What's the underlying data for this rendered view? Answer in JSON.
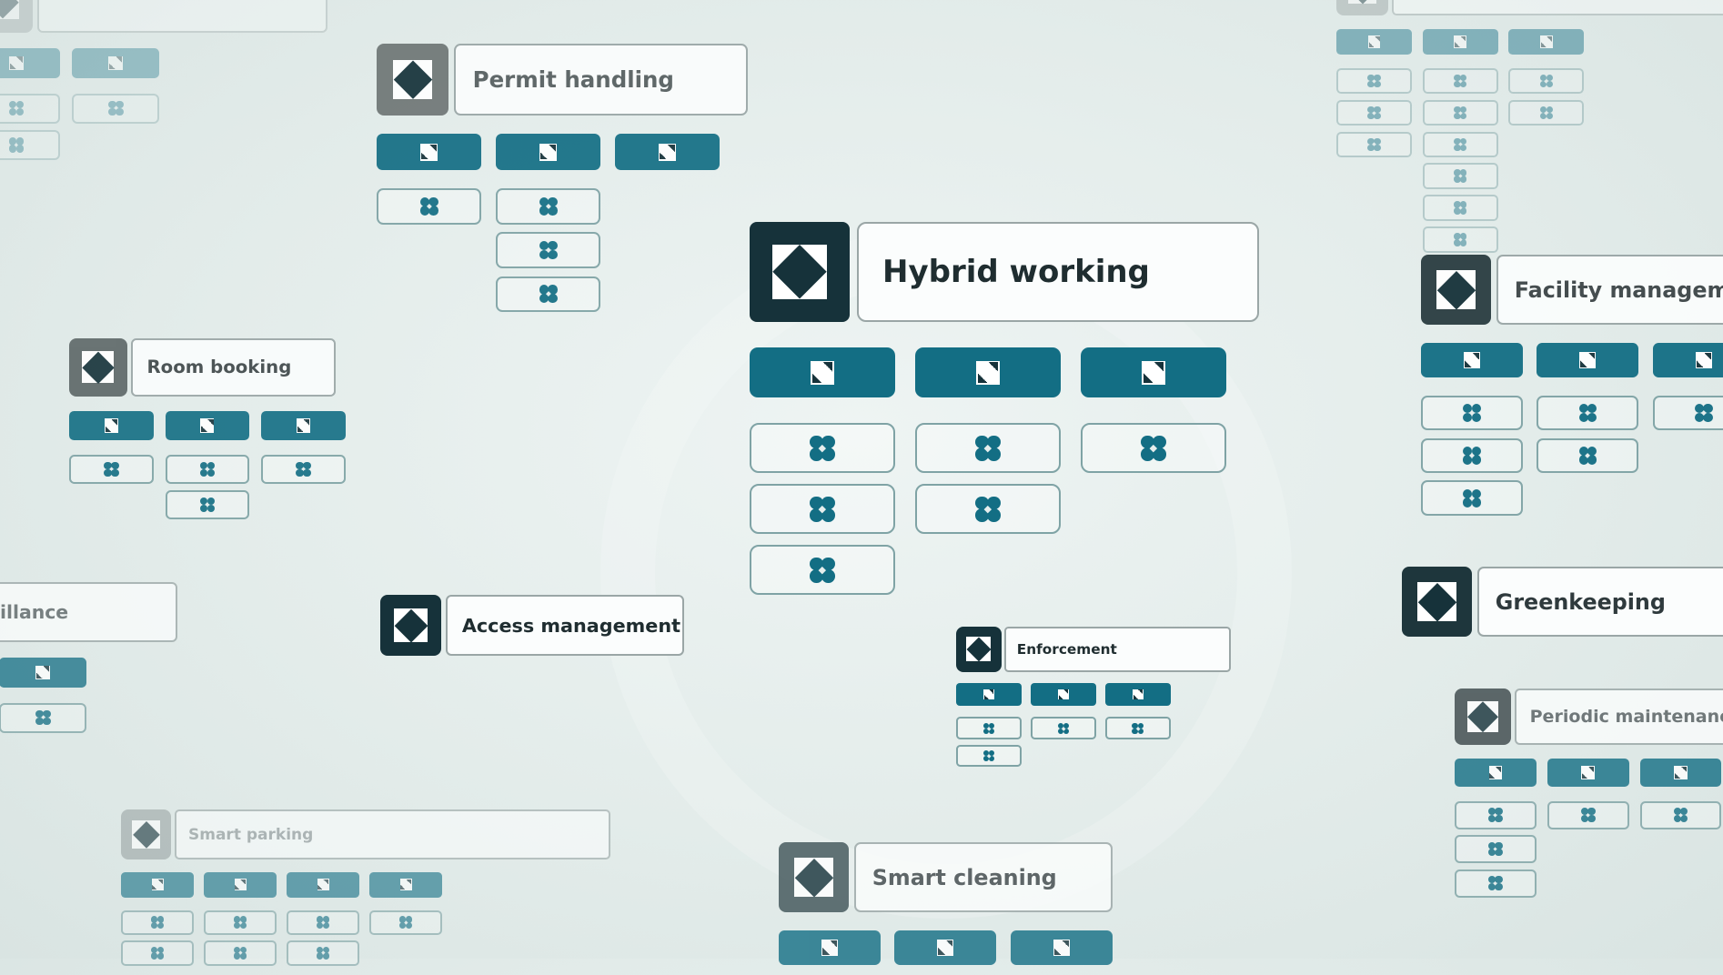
{
  "scene": {
    "description": "Modular smart-building services overview",
    "colors": {
      "accent_teal": "#136e84",
      "icon_dark": "#16323a",
      "tile_border": "#7fa3a5",
      "background": "#e3ecea",
      "title_text": "#1f2d30"
    }
  },
  "modules": [
    {
      "id": "hybrid-working",
      "title": "Hybrid working",
      "emphasis": "primary",
      "icon": "diamond-icon",
      "columns": [
        3,
        2,
        1
      ]
    },
    {
      "id": "permit-handling",
      "title": "Permit handling",
      "emphasis": "secondary",
      "icon": "diamond-icon",
      "columns": [
        1,
        3,
        0
      ]
    },
    {
      "id": "room-booking",
      "title": "Room booking",
      "emphasis": "secondary",
      "icon": "diamond-icon",
      "columns": [
        1,
        2,
        1
      ]
    },
    {
      "id": "surveillance",
      "title": "Surveillance",
      "visible_title": "rveillance",
      "emphasis": "faded",
      "icon": "diamond-icon",
      "columns": [
        2,
        1
      ]
    },
    {
      "id": "access-management",
      "title": "Access management",
      "emphasis": "secondary",
      "icon": "diamond-icon",
      "columns": []
    },
    {
      "id": "enforcement",
      "title": "Enforcement",
      "emphasis": "secondary",
      "icon": "diamond-icon",
      "columns": [
        2,
        1,
        1
      ]
    },
    {
      "id": "facility-management",
      "title": "Facility management",
      "visible_title": "Facility managemer",
      "emphasis": "secondary",
      "icon": "diamond-icon",
      "columns": [
        3,
        2,
        1
      ]
    },
    {
      "id": "greenkeeping",
      "title": "Greenkeeping",
      "emphasis": "secondary",
      "icon": "diamond-icon",
      "columns": []
    },
    {
      "id": "periodic-maintenance",
      "title": "Periodic maintenance",
      "emphasis": "faded",
      "icon": "diamond-icon",
      "columns": [
        3,
        1,
        1
      ]
    },
    {
      "id": "smart-parking",
      "title": "Smart parking",
      "emphasis": "faded",
      "icon": "diamond-icon",
      "columns": [
        2,
        2,
        2,
        1
      ]
    },
    {
      "id": "smart-cleaning",
      "title": "Smart cleaning",
      "emphasis": "secondary",
      "icon": "diamond-icon",
      "columns": [
        0,
        0,
        0
      ]
    },
    {
      "id": "asset-management",
      "title": "",
      "emphasis": "faded",
      "icon": "diamond-icon",
      "columns": [
        3,
        6,
        2
      ]
    },
    {
      "id": "unnamed-top-left",
      "title": "",
      "emphasis": "faded",
      "icon": "diamond-icon",
      "columns": [
        2,
        1
      ]
    }
  ],
  "tile_icons": {
    "top_row": "pinwheel-icon",
    "sub_rows": "clover-icon"
  }
}
